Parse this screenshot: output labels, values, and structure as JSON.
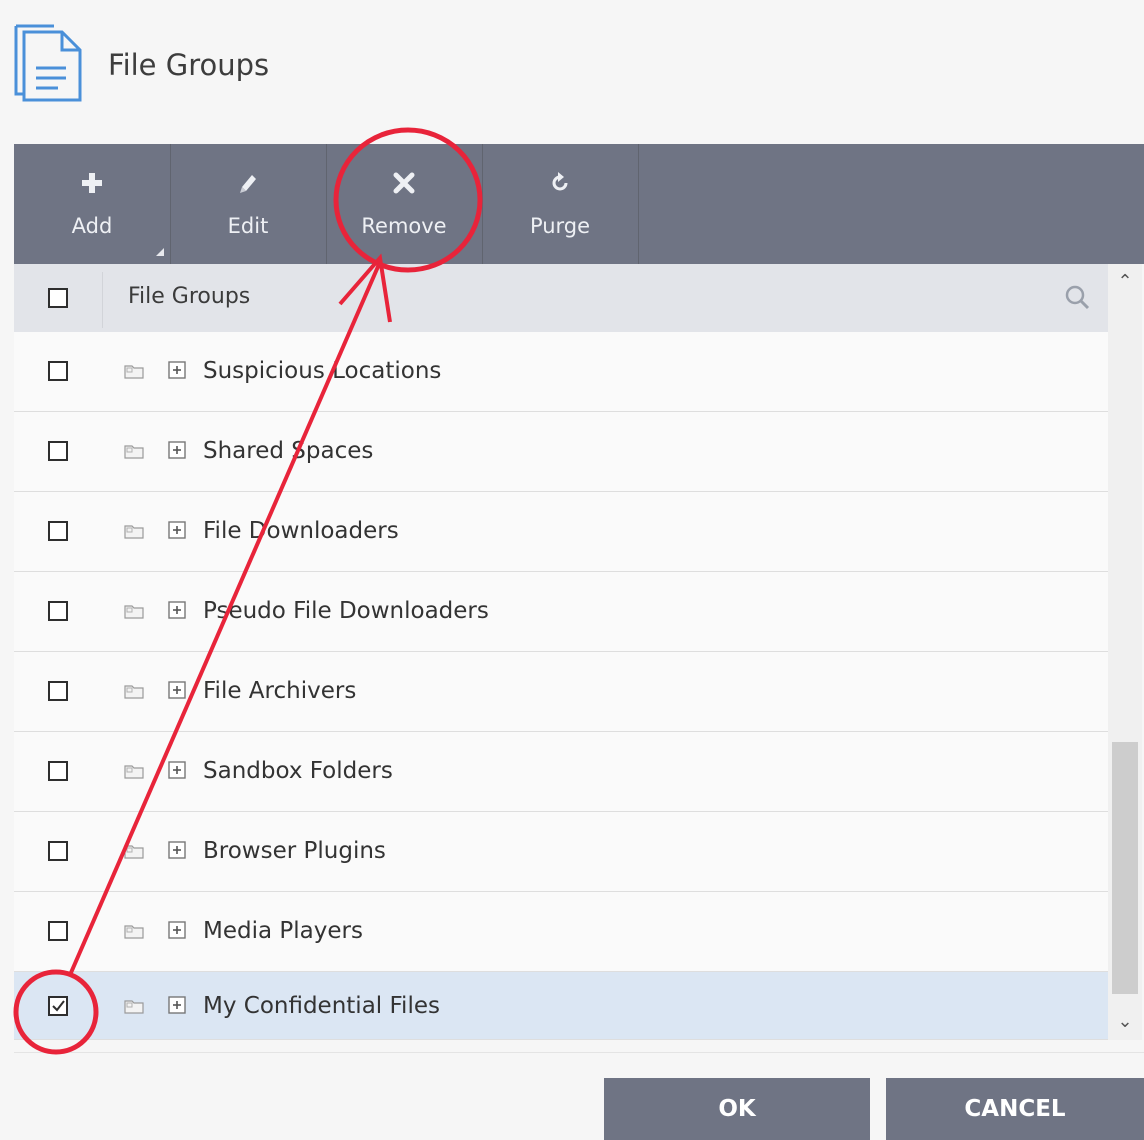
{
  "header": {
    "title": "File Groups"
  },
  "toolbar": {
    "buttons": [
      {
        "label": "Add",
        "icon": "plus-icon"
      },
      {
        "label": "Edit",
        "icon": "pencil-icon"
      },
      {
        "label": "Remove",
        "icon": "x-icon"
      },
      {
        "label": "Purge",
        "icon": "refresh-icon"
      }
    ]
  },
  "grid": {
    "column_header": "File Groups",
    "rows": [
      {
        "name": "Suspicious Locations",
        "checked": false
      },
      {
        "name": "Shared Spaces",
        "checked": false
      },
      {
        "name": "File Downloaders",
        "checked": false
      },
      {
        "name": "Pseudo File Downloaders",
        "checked": false
      },
      {
        "name": "File Archivers",
        "checked": false
      },
      {
        "name": "Sandbox Folders",
        "checked": false
      },
      {
        "name": "Browser Plugins",
        "checked": false
      },
      {
        "name": "Media Players",
        "checked": false
      },
      {
        "name": "My Confidential Files",
        "checked": true
      }
    ]
  },
  "footer": {
    "ok_label": "OK",
    "cancel_label": "CANCEL"
  },
  "colors": {
    "toolbar": "#6f7484",
    "selected_row": "#dbe6f3",
    "annotation": "#e8243a",
    "icon_blue": "#4a90d9"
  }
}
